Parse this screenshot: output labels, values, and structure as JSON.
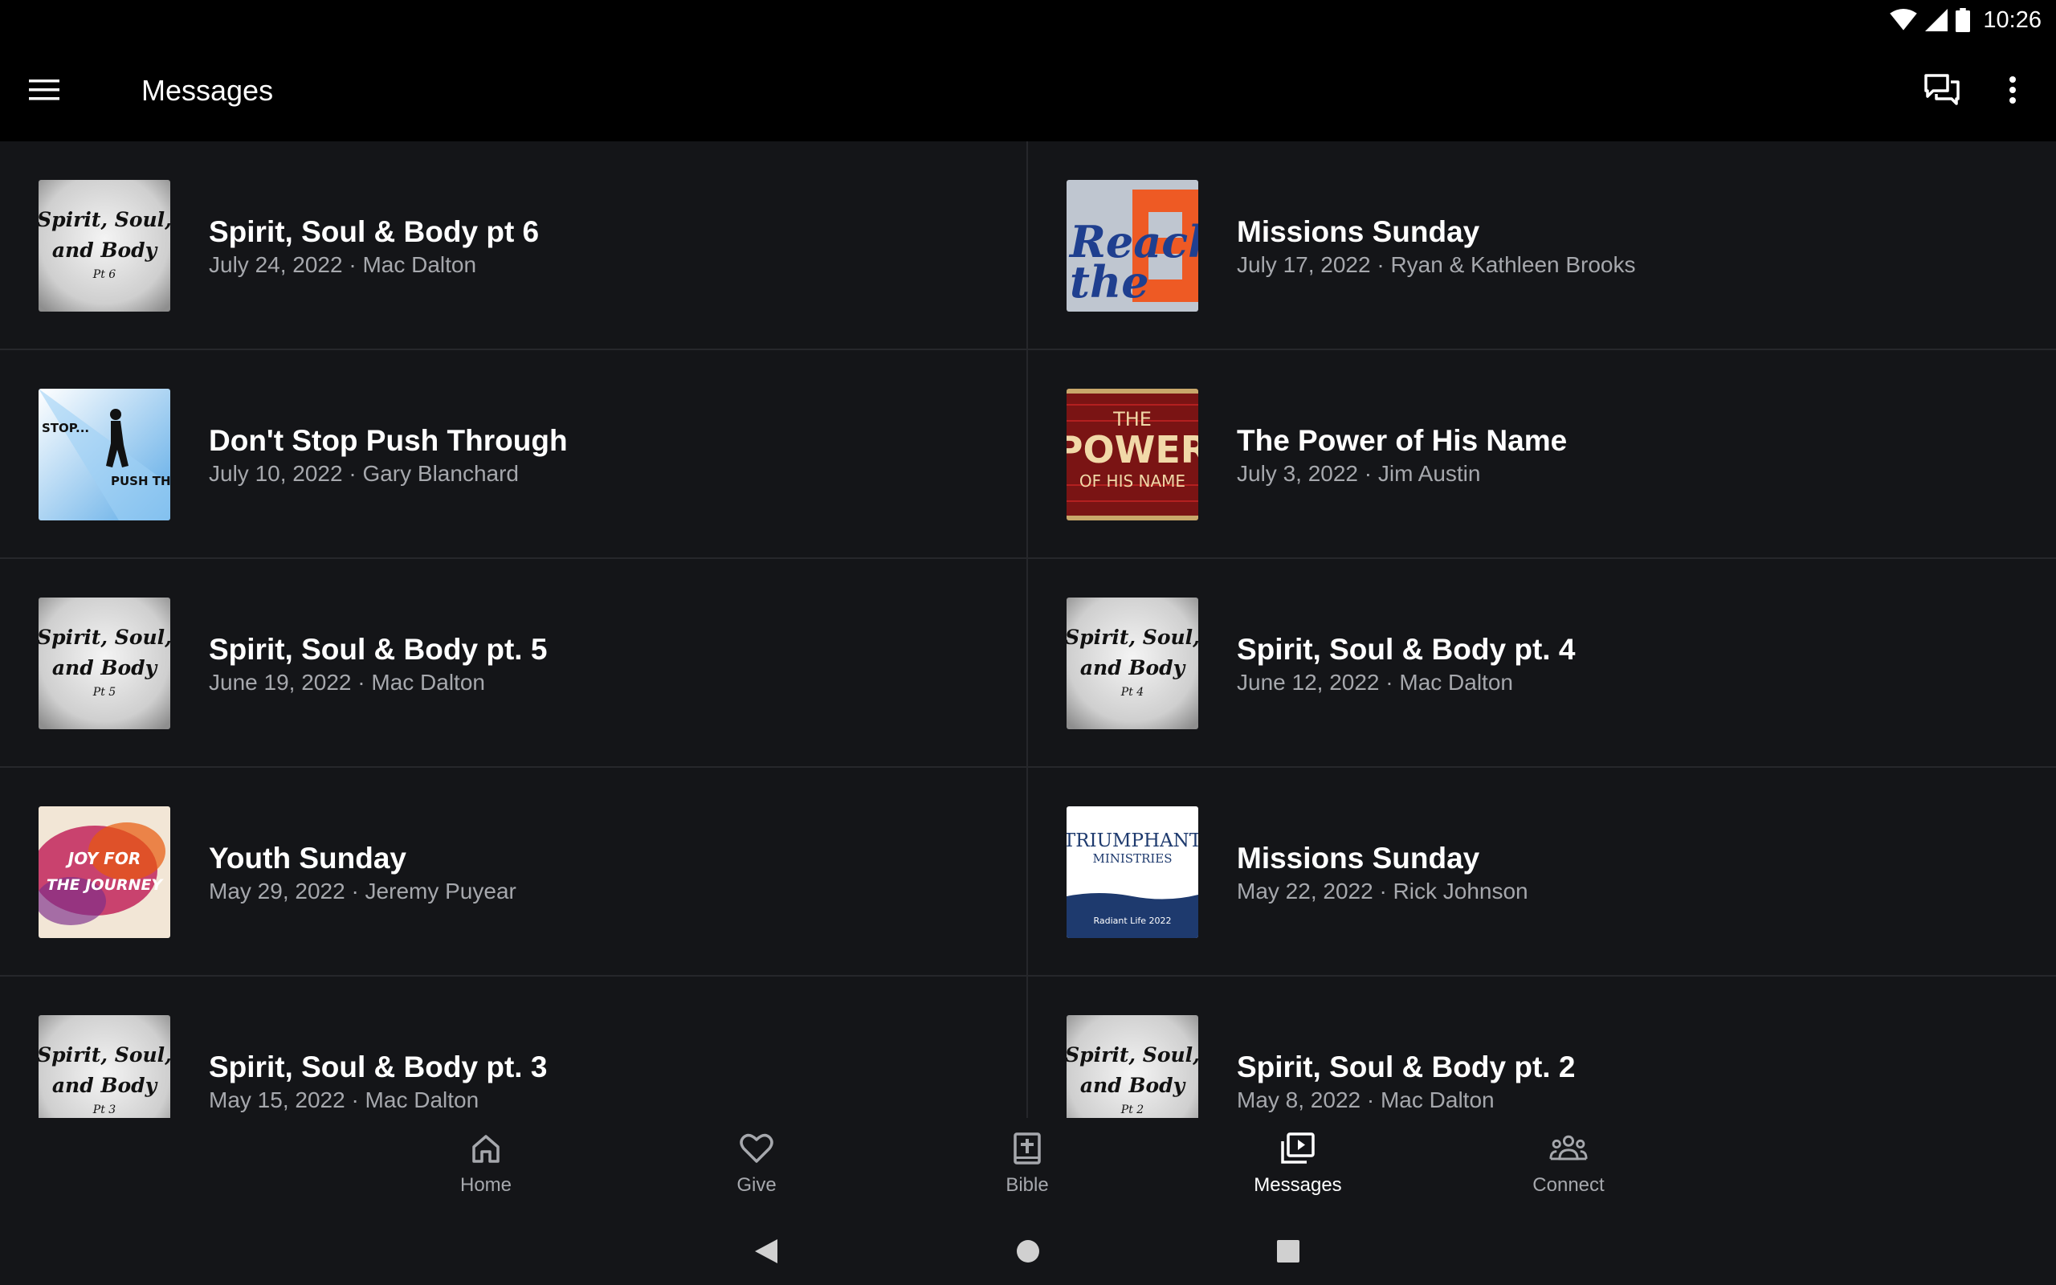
{
  "status": {
    "time": "10:26"
  },
  "appbar": {
    "title": "Messages"
  },
  "messages": [
    {
      "title": "Spirit, Soul & Body pt 6",
      "meta": "July 24, 2022 · Mac Dalton",
      "thumb": {
        "line1": "Spirit, Soul,",
        "line2": "and Body",
        "part": "Pt 6"
      }
    },
    {
      "title": "Missions Sunday",
      "meta": "July 17, 2022 · Ryan & Kathleen Brooks",
      "thumb": {
        "line1": "Reach",
        "line2": "the"
      }
    },
    {
      "title": "Don't Stop Push Through",
      "meta": "July 10, 2022 · Gary Blanchard",
      "thumb": {
        "line1": "STOP...",
        "line2": "PUSH THR"
      }
    },
    {
      "title": "The Power of His Name",
      "meta": "July 3, 2022 · Jim Austin",
      "thumb": {
        "line1": "THE",
        "line2": "POWER",
        "line3": "OF HIS NAME"
      }
    },
    {
      "title": "Spirit, Soul & Body pt. 5",
      "meta": "June 19, 2022 · Mac Dalton",
      "thumb": {
        "line1": "Spirit, Soul,",
        "line2": "and Body",
        "part": "Pt 5"
      }
    },
    {
      "title": "Spirit, Soul & Body pt. 4",
      "meta": "June 12, 2022 · Mac Dalton",
      "thumb": {
        "line1": "Spirit, Soul,",
        "line2": "and Body",
        "part": "Pt 4"
      }
    },
    {
      "title": "Youth Sunday",
      "meta": "May 29, 2022 · Jeremy Puyear",
      "thumb": {
        "line1": "JOY FOR",
        "line2": "THE JOURNEY"
      }
    },
    {
      "title": "Missions Sunday",
      "meta": "May 22, 2022 · Rick Johnson",
      "thumb": {
        "line1": "TRIUMPHANT",
        "line2": "MINISTRIES",
        "line3": "Radiant Life 2022"
      }
    },
    {
      "title": "Spirit, Soul & Body pt. 3",
      "meta": "May 15, 2022 · Mac Dalton",
      "thumb": {
        "line1": "Spirit, Soul,",
        "line2": "and Body",
        "part": "Pt 3"
      }
    },
    {
      "title": "Spirit, Soul & Body pt. 2",
      "meta": "May 8, 2022 · Mac Dalton",
      "thumb": {
        "line1": "Spirit, Soul,",
        "line2": "and Body",
        "part": "Pt 2"
      }
    }
  ],
  "bottom_nav": {
    "home": "Home",
    "give": "Give",
    "bible": "Bible",
    "messages": "Messages",
    "connect": "Connect"
  },
  "colors": {
    "background": "#141518",
    "appbar": "#000000",
    "secondary_text": "#a6a8ad",
    "divider": "#26272b"
  }
}
